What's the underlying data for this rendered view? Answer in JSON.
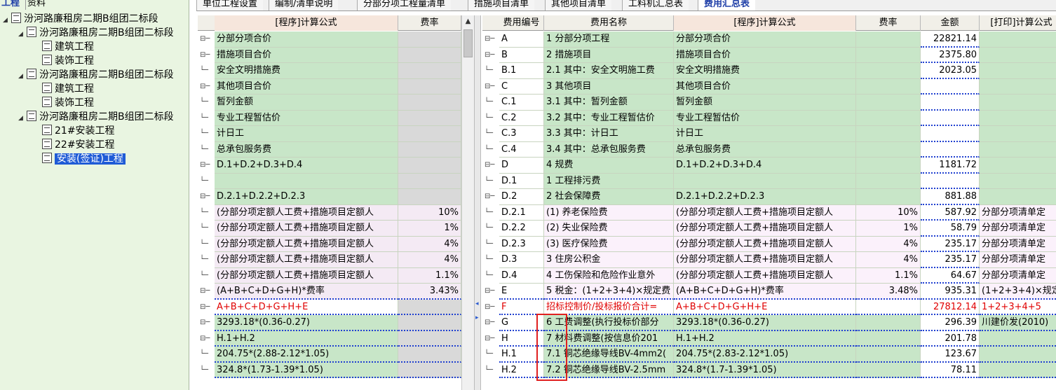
{
  "left_tabs": [
    "工程",
    "资料"
  ],
  "tree": [
    {
      "label": "汾河路廉租房二期B组团二标段",
      "level": 0,
      "toggle": "◢"
    },
    {
      "label": "汾河路廉租房二期B组团二标段",
      "level": 1,
      "toggle": "◢"
    },
    {
      "label": "建筑工程",
      "level": 2
    },
    {
      "label": "装饰工程",
      "level": 2
    },
    {
      "label": "汾河路廉租房二期B组团二标段",
      "level": 1,
      "toggle": "◢"
    },
    {
      "label": "建筑工程",
      "level": 2
    },
    {
      "label": "装饰工程",
      "level": 2
    },
    {
      "label": "汾河路廉租房二期B组团二标段",
      "level": 1,
      "toggle": "◢"
    },
    {
      "label": "21#安装工程",
      "level": 2
    },
    {
      "label": "22#安装工程",
      "level": 2
    },
    {
      "label": "安装(签证)工程",
      "level": 2,
      "selected": true
    }
  ],
  "top_tabs": [
    "单位工程设置",
    "编制/清单说明",
    "分部分项工程量清单",
    "措施项目清单",
    "其他项目清单",
    "工料机汇总表",
    "费用汇总表"
  ],
  "active_tab": "费用汇总表",
  "mid_headers": [
    "[程序]计算公式",
    "费率"
  ],
  "mid_rows": [
    {
      "formula": "分部分项合价",
      "rate": ""
    },
    {
      "formula": "措施项目合价",
      "rate": ""
    },
    {
      "formula": "安全文明措施费",
      "rate": ""
    },
    {
      "formula": "其他项目合价",
      "rate": ""
    },
    {
      "formula": "暂列金额",
      "rate": ""
    },
    {
      "formula": "专业工程暂估价",
      "rate": ""
    },
    {
      "formula": "计日工",
      "rate": ""
    },
    {
      "formula": "总承包服务费",
      "rate": ""
    },
    {
      "formula": "D.1+D.2+D.3+D.4",
      "rate": ""
    },
    {
      "formula": "",
      "rate": ""
    },
    {
      "formula": "D.2.1+D.2.2+D.2.3",
      "rate": ""
    },
    {
      "formula": "(分部分项定额人工费+措施项目定额人",
      "rate": "10%"
    },
    {
      "formula": "(分部分项定额人工费+措施项目定额人",
      "rate": "1%"
    },
    {
      "formula": "(分部分项定额人工费+措施项目定额人",
      "rate": "4%"
    },
    {
      "formula": "(分部分项定额人工费+措施项目定额人",
      "rate": "4%"
    },
    {
      "formula": "(分部分项定额人工费+措施项目定额人",
      "rate": "1.1%"
    },
    {
      "formula": "(A+B+C+D+G+H)*费率",
      "rate": "3.43%"
    },
    {
      "formula": "A+B+C+D+G+H+E",
      "rate": ""
    },
    {
      "formula": "3293.18*(0.36-0.27)",
      "rate": ""
    },
    {
      "formula": "H.1+H.2",
      "rate": ""
    },
    {
      "formula": "204.75*(2.88-2.12*1.05)",
      "rate": ""
    },
    {
      "formula": "324.8*(1.73-1.39*1.05)",
      "rate": ""
    }
  ],
  "right_headers": [
    "费用编号",
    "费用名称",
    "[程序]计算公式",
    "费率",
    "金额",
    "[打印]计算公式"
  ],
  "right_rows": [
    {
      "code": "A",
      "name": "1 分部分项工程",
      "formula": "分部分项合价",
      "rate": "",
      "amount": "22821.14",
      "print": ""
    },
    {
      "code": "B",
      "name": "2 措施项目",
      "formula": "措施项目合价",
      "rate": "",
      "amount": "2375.80",
      "print": ""
    },
    {
      "code": "B.1",
      "name": "2.1 其中：安全文明施工费",
      "formula": "安全文明措施费",
      "rate": "",
      "amount": "2023.05",
      "print": ""
    },
    {
      "code": "C",
      "name": "3 其他项目",
      "formula": "其他项目合价",
      "rate": "",
      "amount": "",
      "print": ""
    },
    {
      "code": "C.1",
      "name": "3.1 其中：暂列金额",
      "formula": "暂列金额",
      "rate": "",
      "amount": "",
      "print": ""
    },
    {
      "code": "C.2",
      "name": "3.2 其中：专业工程暂估价",
      "formula": "专业工程暂估价",
      "rate": "",
      "amount": "",
      "print": ""
    },
    {
      "code": "C.3",
      "name": "3.3 其中：计日工",
      "formula": "计日工",
      "rate": "",
      "amount": "",
      "print": ""
    },
    {
      "code": "C.4",
      "name": "3.4 其中：总承包服务费",
      "formula": "总承包服务费",
      "rate": "",
      "amount": "",
      "print": ""
    },
    {
      "code": "D",
      "name": "4 规费",
      "formula": "D.1+D.2+D.3+D.4",
      "rate": "",
      "amount": "1181.72",
      "print": ""
    },
    {
      "code": "D.1",
      "name": "1 工程排污费",
      "formula": "",
      "rate": "",
      "amount": "",
      "print": ""
    },
    {
      "code": "D.2",
      "name": "2 社会保障费",
      "formula": "D.2.1+D.2.2+D.2.3",
      "rate": "",
      "amount": "881.88",
      "print": ""
    },
    {
      "code": "D.2.1",
      "name": "(1) 养老保险费",
      "formula": "(分部分项定额人工费+措施项目定额人",
      "rate": "10%",
      "amount": "587.92",
      "print": "分部分项清单定"
    },
    {
      "code": "D.2.2",
      "name": "(2) 失业保险费",
      "formula": "(分部分项定额人工费+措施项目定额人",
      "rate": "1%",
      "amount": "58.79",
      "print": "分部分项清单定"
    },
    {
      "code": "D.2.3",
      "name": "(3) 医疗保险费",
      "formula": "(分部分项定额人工费+措施项目定额人",
      "rate": "4%",
      "amount": "235.17",
      "print": "分部分项清单定"
    },
    {
      "code": "D.3",
      "name": "3 住房公积金",
      "formula": "(分部分项定额人工费+措施项目定额人",
      "rate": "4%",
      "amount": "235.17",
      "print": "分部分项清单定"
    },
    {
      "code": "D.4",
      "name": "4 工伤保险和危险作业意外",
      "formula": "(分部分项定额人工费+措施项目定额人",
      "rate": "1.1%",
      "amount": "64.67",
      "print": "分部分项清单定"
    },
    {
      "code": "E",
      "name": "5 税金：(1+2+3+4)×规定费",
      "formula": "(A+B+C+D+G+H)*费率",
      "rate": "3.48%",
      "amount": "935.31",
      "print": "(1+2+3+4)×规定"
    },
    {
      "code": "F",
      "name": "招标控制价/投标报价合计=",
      "formula": "A+B+C+D+G+H+E",
      "rate": "",
      "amount": "27812.14",
      "print": "1+2+3+4+5"
    },
    {
      "code": "G",
      "name": "6 工费调整(执行投标价部分",
      "formula": "3293.18*(0.36-0.27)",
      "rate": "",
      "amount": "296.39",
      "print": "川建价发(2010)"
    },
    {
      "code": "H",
      "name": "7 材料费调整(按信息价201",
      "formula": "H.1+H.2",
      "rate": "",
      "amount": "201.78",
      "print": ""
    },
    {
      "code": "H.1",
      "name": "7.1 铜芯绝缘导线BV-4mm2(",
      "formula": "204.75*(2.83-2.12*1.05)",
      "rate": "",
      "amount": "123.67",
      "print": ""
    },
    {
      "code": "H.2",
      "name": "7.2 铜芯绝缘导线BV-2.5mm",
      "formula": "324.8*(1.7-1.39*1.05)",
      "rate": "",
      "amount": "78.11",
      "print": ""
    }
  ],
  "colors": {
    "green": "#c8e6c8",
    "pink": "#f4eaf4",
    "selected": "#1f5bd6",
    "red": "#e00000",
    "active_tab": "#1f3fa8"
  }
}
